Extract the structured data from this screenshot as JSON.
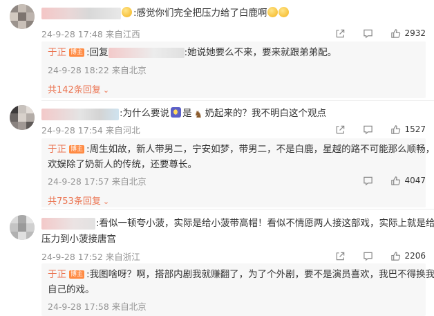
{
  "comments": [
    {
      "text": ":感觉你们完全把压力给了白鹿啊",
      "meta": "24-9-28 17:48 来自江西",
      "likes": "2932",
      "reply": {
        "name": "于正",
        "badge": "博主",
        "text_prefix": ":回复",
        "text_suffix": ":她说她要么不来，要来就跟弟弟配。",
        "meta": "24-9-28 18:22 来自北京"
      },
      "more": "共142条回复"
    },
    {
      "text_prefix": ":为什么要说",
      "text_mid": "是",
      "text_suffix": "奶起来的？我不明白这个观点",
      "meta": "24-9-28 17:54 来自河北",
      "likes": "1527",
      "reply": {
        "name": "于正",
        "badge": "博主",
        "text_line1": ":周生如故，新人带男二，宁安如梦，带男二，不是白鹿，星越的路不可能那么顺畅，",
        "text_line2": "欢娱除了奶新人的传统，还要尊长。",
        "meta": "24-9-28 17:57 来自北京",
        "likes": "4047"
      },
      "more": "共753条回复"
    },
    {
      "text_line1": ":看似一顿夸小菠，实际是给小菠带高帽！看似不情愿两人接这部戏，实际上就是给",
      "text_line2": "压力到小菠接唐宫",
      "meta": "24-9-28 17:52 来自浙江",
      "likes": "2206",
      "reply": {
        "name": "于正",
        "badge": "博主",
        "text_line1": ":我图啥呀？啊，搭部内剧我就赚翻了，为了个外剧，要不是演员喜欢，我巴不得换我",
        "text_line2": "自己的戏。",
        "meta": "24-9-28 17:58 来自北京"
      }
    }
  ],
  "icons": {
    "share": "share-icon",
    "comment": "comment-icon",
    "like": "like-icon"
  }
}
